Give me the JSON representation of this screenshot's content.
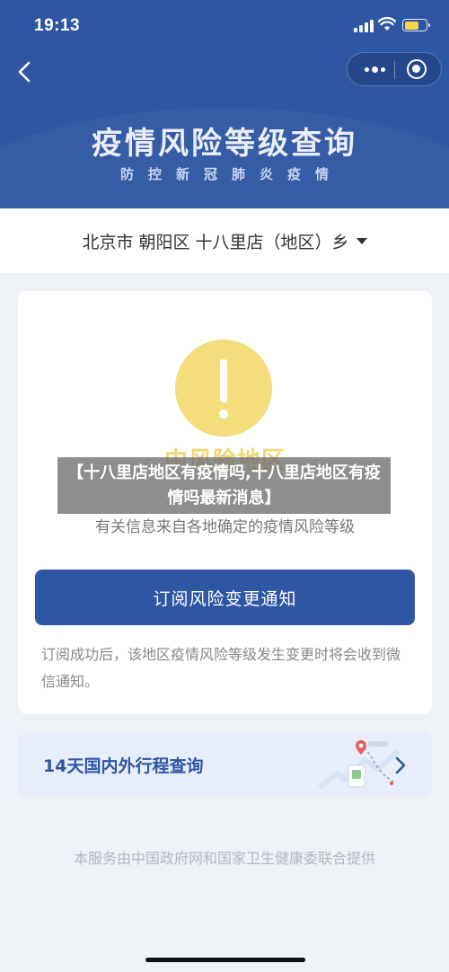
{
  "status_bar": {
    "time": "19:13"
  },
  "header": {
    "title": "疫情风险等级查询",
    "subtitle": "防控新冠肺炎疫情"
  },
  "region": {
    "label": "北京市 朝阳区 十八里店（地区）乡"
  },
  "risk_card": {
    "level": "中风险地区",
    "info": "有关信息来自各地确定的疫情风险等级",
    "subscribe_label": "订阅风险变更通知",
    "subscribe_note": "订阅成功后，该地区疫情风险等级发生变更时将会收到微信通知。"
  },
  "trip": {
    "label": "14天国内外行程查询"
  },
  "footer": {
    "text": "本服务由中国政府网和国家卫生健康委联合提供"
  },
  "overlay": {
    "caption": "【十八里店地区有疫情吗,十八里店地区有疫情吗最新消息】"
  },
  "colors": {
    "brand_blue": "#2f56a3",
    "warning_yellow": "#f4de7c",
    "page_bg": "#eef1f6"
  },
  "icons": [
    "back-icon",
    "more-icon",
    "target-icon",
    "warning-icon",
    "chevron-down-icon",
    "chevron-right-icon",
    "map-illustration"
  ]
}
